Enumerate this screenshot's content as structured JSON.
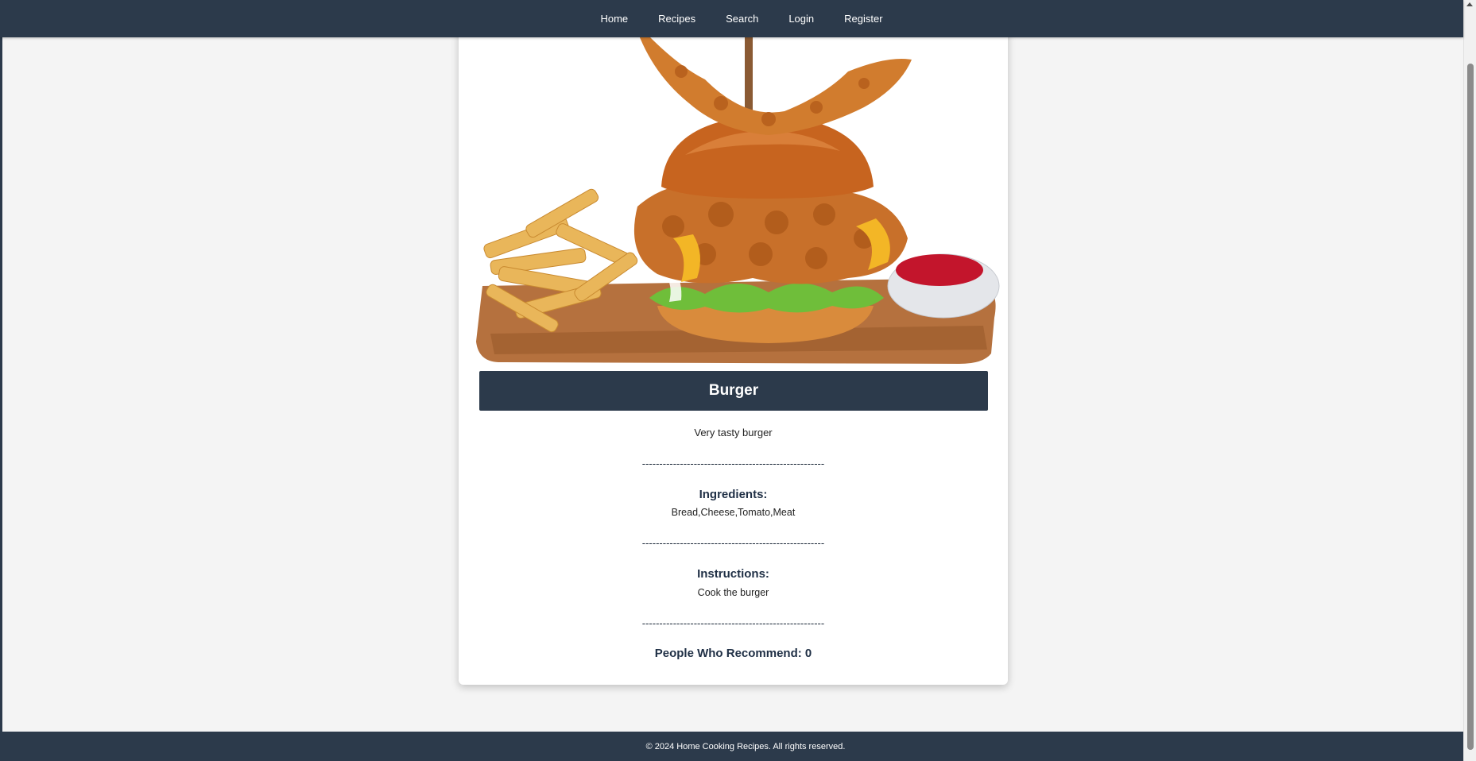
{
  "nav": {
    "items": [
      "Home",
      "Recipes",
      "Search",
      "Login",
      "Register"
    ]
  },
  "recipe": {
    "image_alt": "Crispy chicken burger with fries on a wooden board",
    "title": "Burger",
    "description": "Very tasty burger",
    "divider": "-----------------------------------------------------",
    "ingredients_heading": "Ingredients:",
    "ingredients": "Bread,Cheese,Tomato,Meat",
    "instructions_heading": "Instructions:",
    "instructions": "Cook the burger",
    "recommend_text": "People Who Recommend: 0"
  },
  "footer": {
    "text": "© 2024 Home Cooking Recipes. All rights reserved."
  },
  "colors": {
    "navbar": "#2c3a4b",
    "page_bg": "#f4f4f4",
    "card_bg": "#ffffff",
    "heading_text": "#1f2f45"
  }
}
